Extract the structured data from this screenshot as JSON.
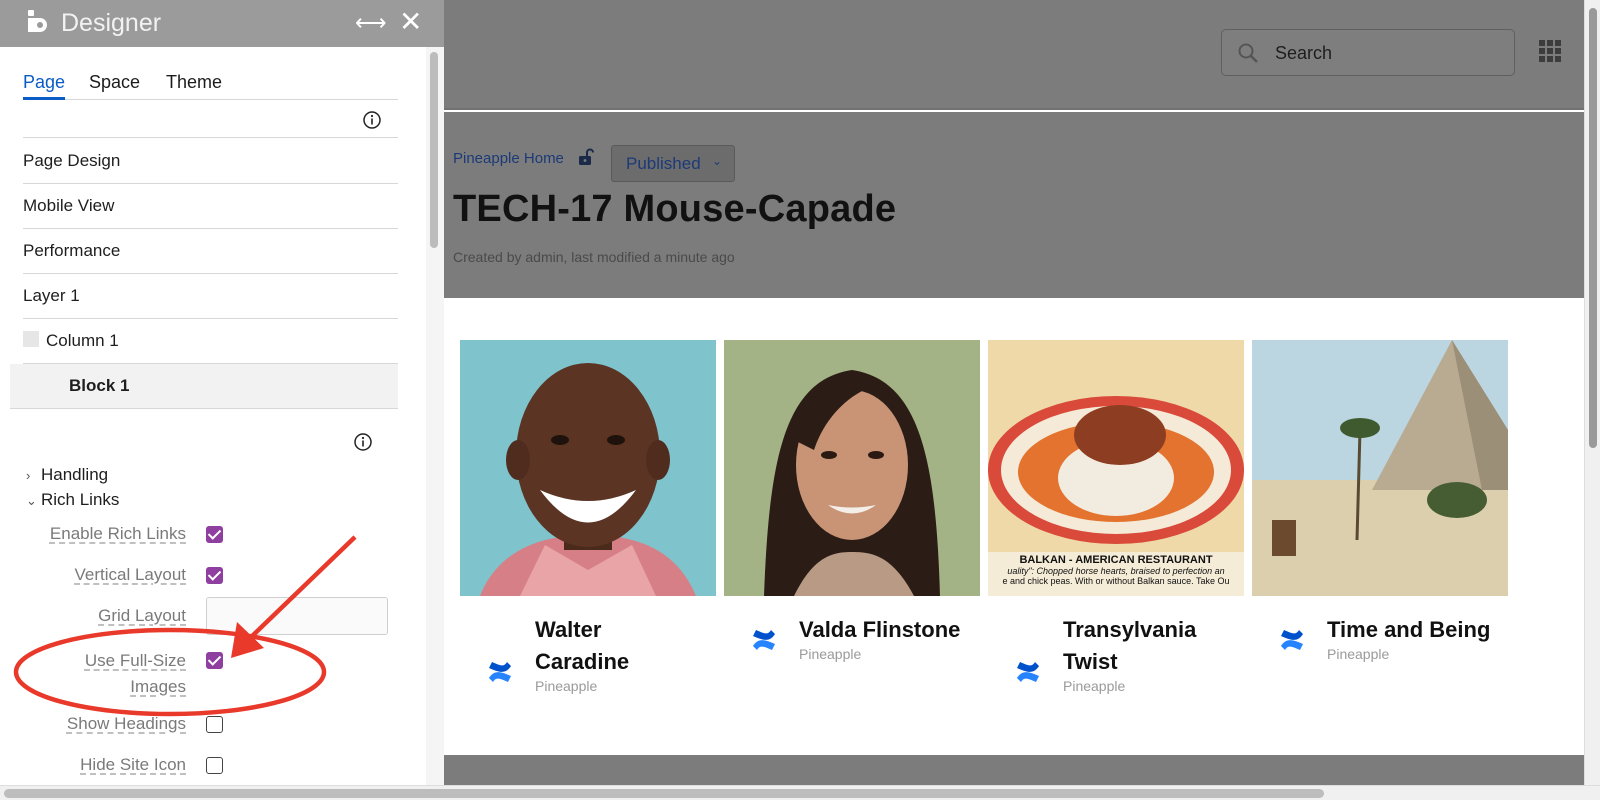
{
  "designer": {
    "title": "Designer",
    "tabs": [
      {
        "label": "Page",
        "active": true
      },
      {
        "label": "Space"
      },
      {
        "label": "Theme"
      }
    ],
    "nav": {
      "page_design": "Page Design",
      "mobile_view": "Mobile View",
      "performance": "Performance",
      "layer": "Layer 1",
      "column": "Column 1",
      "block": "Block 1"
    },
    "tree": {
      "handling": "Handling",
      "rich_links": "Rich Links"
    },
    "options": {
      "enable_rich_links": {
        "label": "Enable Rich Links",
        "checked": true
      },
      "vertical_layout": {
        "label": "Vertical Layout",
        "checked": true
      },
      "grid_layout": {
        "label": "Grid Layout",
        "value": ""
      },
      "use_full_size_images": {
        "label_line1": "Use Full-Size",
        "label_line2": "Images",
        "checked": true
      },
      "show_headings": {
        "label": "Show Headings",
        "checked": false
      },
      "hide_site_icon": {
        "label": "Hide Site Icon",
        "checked": false
      }
    }
  },
  "topbar": {
    "search_placeholder": "Search"
  },
  "page": {
    "breadcrumb": "Pineapple Home",
    "status": "Published",
    "title": "TECH-17 Mouse-Capade",
    "byline": "Created by admin, last modified a minute ago"
  },
  "cards": [
    {
      "name_line1": "Walter",
      "name_line2": "Caradine",
      "space": "Pineapple"
    },
    {
      "name_line1": "Valda Flinstone",
      "name_line2": "",
      "space": "Pineapple"
    },
    {
      "name_line1": "Transylvania",
      "name_line2": "Twist",
      "space": "Pineapple"
    },
    {
      "name_line1": "Time and Being",
      "name_line2": "",
      "space": "Pineapple"
    }
  ],
  "postcard_caption": {
    "heading": "BALKAN - AMERICAN RESTAURANT",
    "line1": "uality\": Chopped horse hearts, braised to perfection an",
    "line2": "e and chick peas. With or without Balkan sauce. Take Ou"
  },
  "colors": {
    "accent": "#0b5cc4",
    "checkbox": "#8e3fa0",
    "annotation": "#e8392a",
    "overlay": "#7c7c7c"
  }
}
